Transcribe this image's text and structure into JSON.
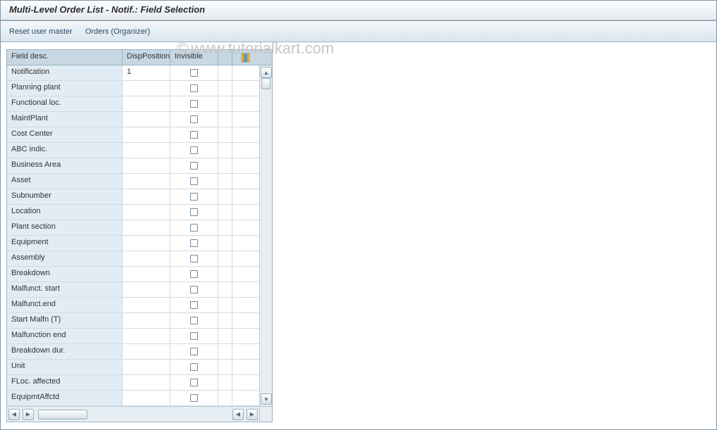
{
  "title": "Multi-Level Order List - Notif.: Field Selection",
  "toolbar": {
    "reset_label": "Reset user master",
    "orders_label": "Orders (Organizer)"
  },
  "headers": {
    "field_desc": "Field desc.",
    "disp_pos": "DispPosition",
    "invisible": "Invisible"
  },
  "rows": [
    {
      "desc": "Notification",
      "disp": "1"
    },
    {
      "desc": "Planning plant",
      "disp": ""
    },
    {
      "desc": "Functional loc.",
      "disp": ""
    },
    {
      "desc": "MaintPlant",
      "disp": ""
    },
    {
      "desc": "Cost Center",
      "disp": ""
    },
    {
      "desc": "ABC indic.",
      "disp": ""
    },
    {
      "desc": "Business Area",
      "disp": ""
    },
    {
      "desc": "Asset",
      "disp": ""
    },
    {
      "desc": "Subnumber",
      "disp": ""
    },
    {
      "desc": "Location",
      "disp": ""
    },
    {
      "desc": "Plant section",
      "disp": ""
    },
    {
      "desc": "Equipment",
      "disp": ""
    },
    {
      "desc": "Assembly",
      "disp": ""
    },
    {
      "desc": "Breakdown",
      "disp": ""
    },
    {
      "desc": "Malfunct. start",
      "disp": ""
    },
    {
      "desc": "Malfunct.end",
      "disp": ""
    },
    {
      "desc": "Start Malfn (T)",
      "disp": ""
    },
    {
      "desc": "Malfunction end",
      "disp": ""
    },
    {
      "desc": "Breakdown dur.",
      "disp": ""
    },
    {
      "desc": "Unit",
      "disp": ""
    },
    {
      "desc": "FLoc. affected",
      "disp": ""
    },
    {
      "desc": "EquipmtAffctd",
      "disp": ""
    }
  ],
  "watermark": "www.tutorialkart.com"
}
